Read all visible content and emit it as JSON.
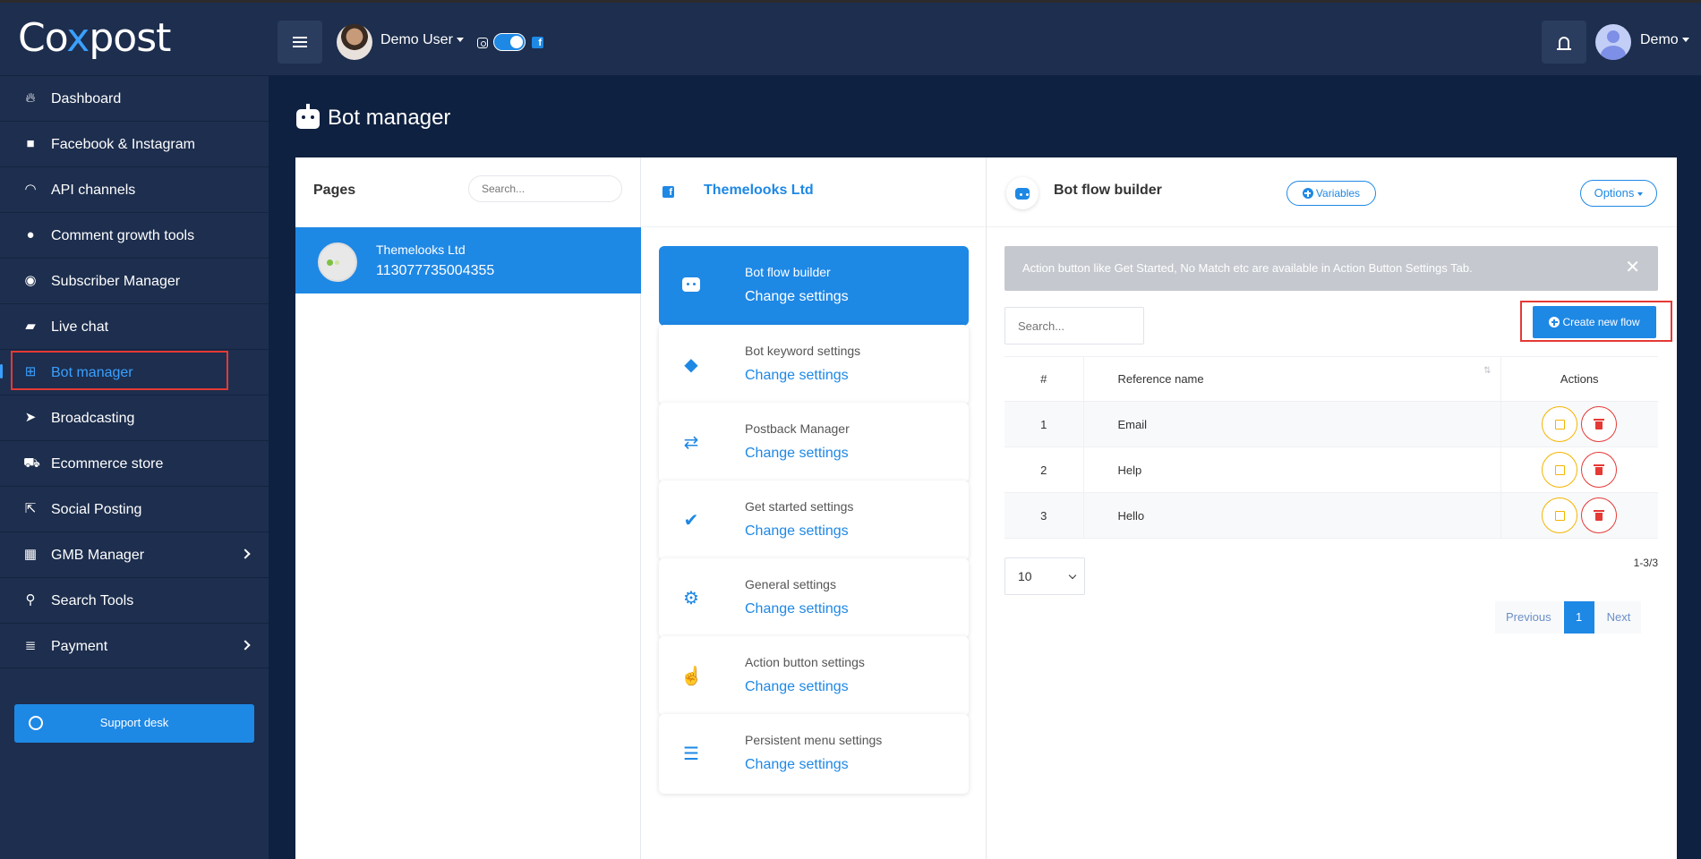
{
  "app": {
    "logo_prefix": "Co",
    "logo_x": "x",
    "logo_suffix": "post"
  },
  "topbar": {
    "user_name": "Demo User",
    "account_name": "Demo"
  },
  "sidebar": {
    "items": [
      {
        "label": "Dashboard",
        "icon": "fire-icon"
      },
      {
        "label": "Facebook & Instagram",
        "icon": "facebook-icon"
      },
      {
        "label": "API channels",
        "icon": "wifi-icon"
      },
      {
        "label": "Comment growth tools",
        "icon": "comments-icon"
      },
      {
        "label": "Subscriber Manager",
        "icon": "user-circle-icon"
      },
      {
        "label": "Live chat",
        "icon": "chat-icon"
      },
      {
        "label": "Bot manager",
        "icon": "sitemap-icon"
      },
      {
        "label": "Broadcasting",
        "icon": "paper-plane-icon"
      },
      {
        "label": "Ecommerce store",
        "icon": "cart-icon"
      },
      {
        "label": "Social Posting",
        "icon": "share-icon"
      },
      {
        "label": "GMB Manager",
        "icon": "store-icon"
      },
      {
        "label": "Search Tools",
        "icon": "search-icon"
      },
      {
        "label": "Payment",
        "icon": "coins-icon"
      }
    ],
    "support_label": "Support desk"
  },
  "header": {
    "title": "Bot manager"
  },
  "pages_panel": {
    "title": "Pages",
    "search_placeholder": "Search...",
    "page": {
      "name": "Themelooks Ltd",
      "id": "113077735004355"
    }
  },
  "settings_panel": {
    "page_name": "Themelooks Ltd",
    "link_label": "Change settings",
    "cards": [
      {
        "title": "Bot flow builder",
        "icon": "robot-icon"
      },
      {
        "title": "Bot keyword settings",
        "icon": "tag-icon"
      },
      {
        "title": "Postback Manager",
        "icon": "exchange-icon"
      },
      {
        "title": "Get started settings",
        "icon": "check-circle-icon"
      },
      {
        "title": "General settings",
        "icon": "gear-icon"
      },
      {
        "title": "Action button settings",
        "icon": "pointer-icon"
      },
      {
        "title": "Persistent menu settings",
        "icon": "bars-icon"
      }
    ]
  },
  "flow_panel": {
    "title": "Bot flow builder",
    "variables_label": "Variables",
    "options_label": "Options",
    "alert_text": "Action button like Get Started, No Match etc are available in Action Button Settings Tab.",
    "search_placeholder": "Search...",
    "create_label": "Create new flow",
    "table": {
      "headers": {
        "num": "#",
        "name": "Reference name",
        "actions": "Actions"
      },
      "rows": [
        {
          "num": "1",
          "name": "Email"
        },
        {
          "num": "2",
          "name": "Help"
        },
        {
          "num": "3",
          "name": "Hello"
        }
      ]
    },
    "page_size": "10",
    "range_text": "1-3/3",
    "pager": {
      "prev": "Previous",
      "current": "1",
      "next": "Next"
    }
  },
  "colors": {
    "primary": "#1e88e5",
    "sidebar": "#1d2e4e",
    "background": "#0f2140",
    "highlight": "#e53935",
    "edit": "#f5b400"
  }
}
